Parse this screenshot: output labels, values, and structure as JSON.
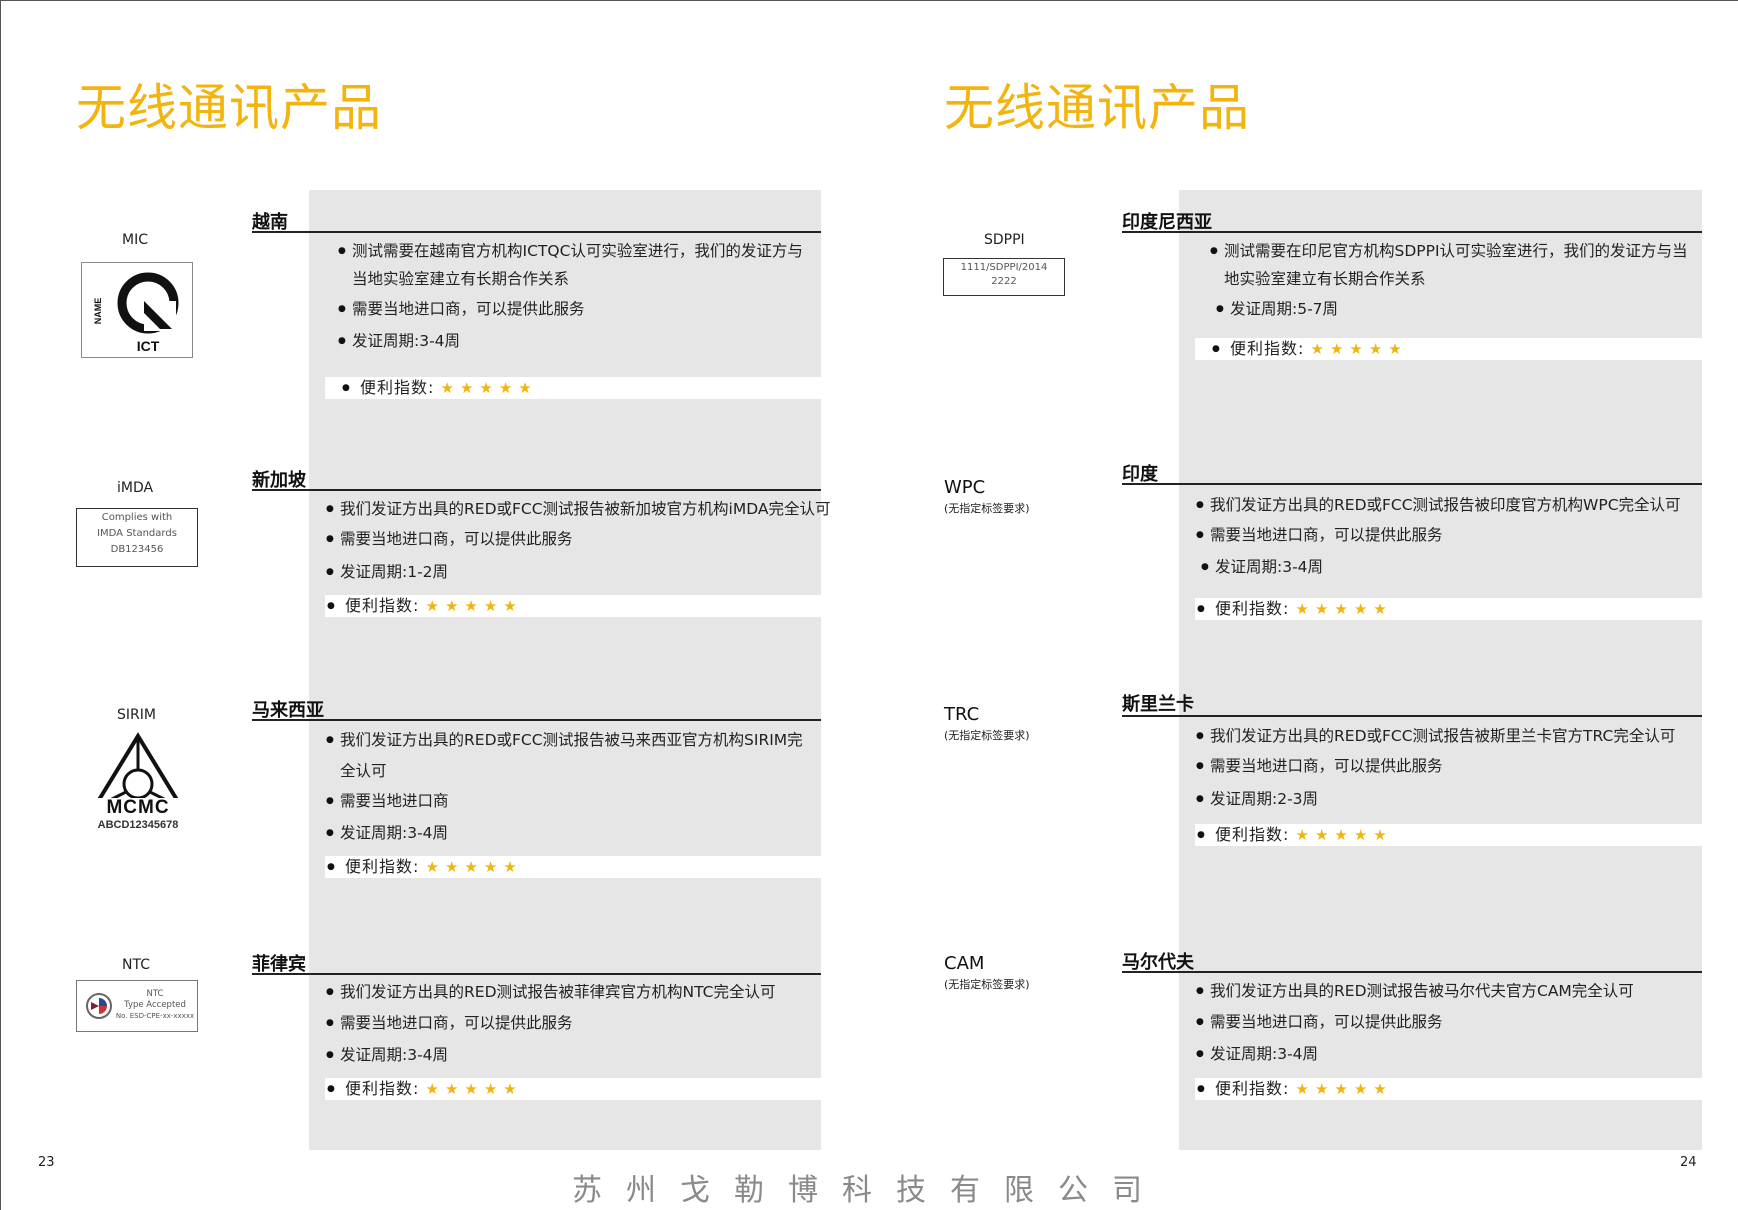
{
  "left_page": {
    "title": "无线通讯产品",
    "page_number": "23",
    "sections": [
      {
        "country": "越南",
        "mark_label": "MIC",
        "logo_text_name": "NAME",
        "logo_text_ict": "ICT",
        "bullets": [
          "测试需要在越南官方机构ICTQC认可实验室进行，我们的发证方与当地实验室建立有长期合作关系",
          "需要当地进口商，可以提供此服务",
          "发证周期:3-4周"
        ],
        "convenience_label": "便利指数:",
        "stars": "★★★★★"
      },
      {
        "country": "新加坡",
        "mark_label": "iMDA",
        "logo_lines": [
          "Complies with",
          "IMDA Standards",
          "DB123456"
        ],
        "bullets": [
          "我们发证方出具的RED或FCC测试报告被新加坡官方机构iMDA完全认可",
          "需要当地进口商，可以提供此服务",
          "发证周期:1-2周"
        ],
        "convenience_label": "便利指数:",
        "stars": "★★★★★"
      },
      {
        "country": "马来西亚",
        "mark_label": "SIRIM",
        "logo_text_mcmc": "MCMC",
        "logo_text_code": "ABCD12345678",
        "bullets": [
          "我们发证方出具的RED或FCC测试报告被马来西亚官方机构SIRIM完全认可",
          "需要当地进口商",
          "发证周期:3-4周"
        ],
        "convenience_label": "便利指数:",
        "stars": "★★★★★"
      },
      {
        "country": "菲律宾",
        "mark_label": "NTC",
        "logo_lines": [
          "NTC",
          "Type Accepted",
          "No. ESD-CPE-xx-xxxxx"
        ],
        "bullets": [
          "我们发证方出具的RED测试报告被菲律宾官方机构NTC完全认可",
          "需要当地进口商，可以提供此服务",
          "发证周期:3-4周"
        ],
        "convenience_label": "便利指数:",
        "stars": "★★★★★"
      }
    ]
  },
  "right_page": {
    "title": "无线通讯产品",
    "page_number": "24",
    "sections": [
      {
        "country": "印度尼西亚",
        "mark_label": "SDPPI",
        "logo_lines": [
          "1111/SDPPI/2014",
          "2222"
        ],
        "bullets": [
          "测试需要在印尼官方机构SDPPI认可实验室进行，我们的发证方与当地实验室建立有长期合作关系",
          "发证周期:5-7周"
        ],
        "convenience_label": "便利指数:",
        "stars": "★★★★★"
      },
      {
        "country": "印度",
        "mark_name": "WPC",
        "mark_note": "(无指定标签要求)",
        "bullets": [
          "我们发证方出具的RED或FCC测试报告被印度官方机构WPC完全认可",
          "需要当地进口商，可以提供此服务",
          "发证周期:3-4周"
        ],
        "convenience_label": "便利指数:",
        "stars": "★★★★★"
      },
      {
        "country": "斯里兰卡",
        "mark_name": "TRC",
        "mark_note": "(无指定标签要求)",
        "bullets": [
          "我们发证方出具的RED或FCC测试报告被斯里兰卡官方TRC完全认可",
          "需要当地进口商，可以提供此服务",
          "发证周期:2-3周"
        ],
        "convenience_label": "便利指数:",
        "stars": "★★★★★"
      },
      {
        "country": "马尔代夫",
        "mark_name": "CAM",
        "mark_note": "(无指定标签要求)",
        "bullets": [
          "我们发证方出具的RED测试报告被马尔代夫官方CAM完全认可",
          "需要当地进口商，可以提供此服务",
          "发证周期:3-4周"
        ],
        "convenience_label": "便利指数:",
        "stars": "★★★★★"
      }
    ]
  },
  "footer": "苏州戈勒博科技有限公司",
  "colors": {
    "accent": "#F2B40F",
    "panel": "#E6E6E7",
    "text": "#222222"
  }
}
